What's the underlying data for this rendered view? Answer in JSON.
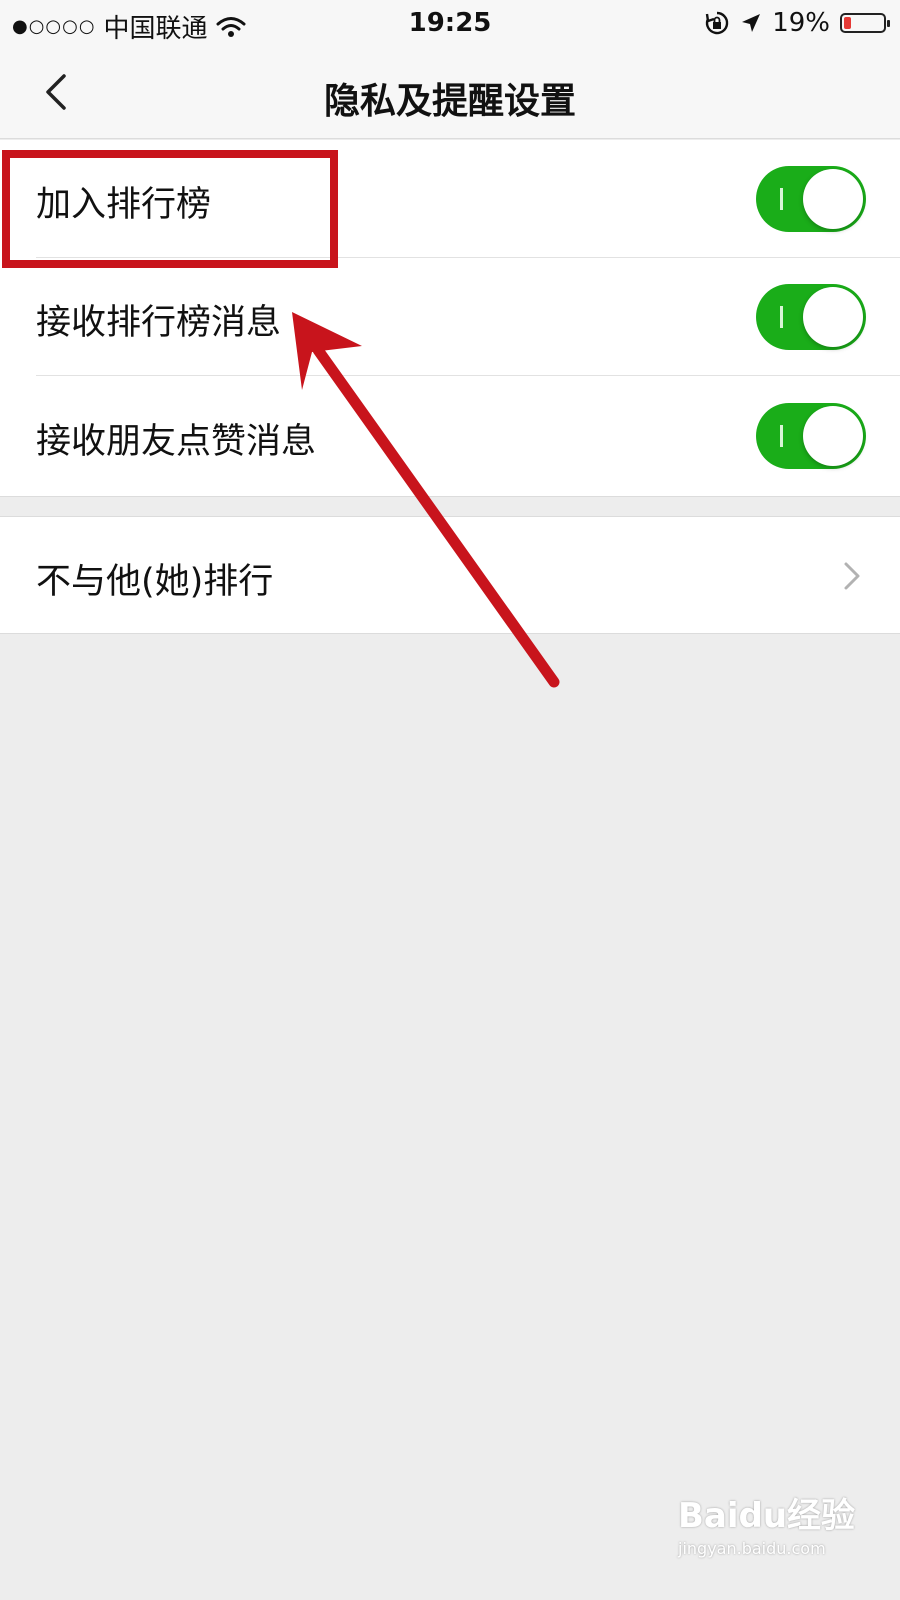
{
  "status_bar": {
    "signal": "●○○○○",
    "carrier": "中国联通",
    "time": "19:25",
    "battery_percent": "19%",
    "battery_level": 0.19,
    "icons": [
      "wifi-icon",
      "orientation-lock-icon",
      "location-arrow-icon",
      "battery-icon"
    ]
  },
  "nav": {
    "title": "隐私及提醒设置",
    "back_icon": "chevron-left-icon"
  },
  "settings": [
    {
      "label": "加入排行榜",
      "toggle_on": true
    },
    {
      "label": "接收排行榜消息",
      "toggle_on": true
    },
    {
      "label": "接收朋友点赞消息",
      "toggle_on": true
    }
  ],
  "exclude_row": {
    "label": "不与他(她)排行",
    "icon": "chevron-right-icon"
  },
  "watermark": {
    "brand": "Baidu经验",
    "url": "jingyan.baidu.com"
  },
  "colors": {
    "toggle_on": "#1aad19",
    "annotation_red": "#c8141c",
    "background": "#ededed"
  }
}
